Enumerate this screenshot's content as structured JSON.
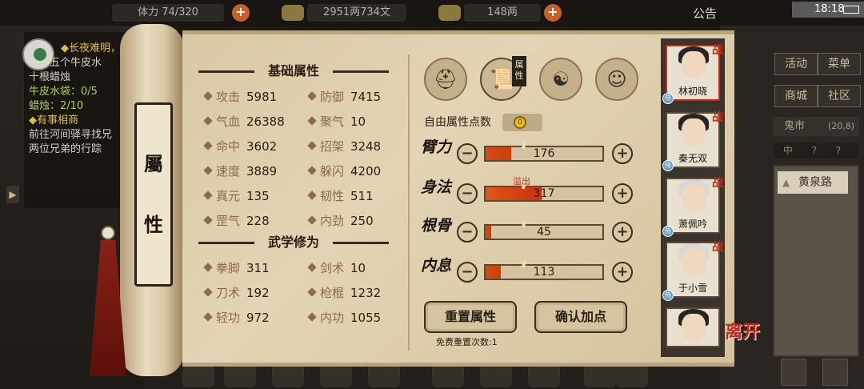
{
  "topbar": {
    "stamina": "体力 74/320",
    "money": "2951两734文",
    "gold": "148两",
    "notice": "公告",
    "time": "18:18"
  },
  "quest": {
    "q1_title": "◆长夜难明，",
    "q1_desc1": "筹备五个牛皮水",
    "q1_desc2": "十根蜡烛",
    "q1_prog1": "牛皮水袋：0/5",
    "q1_prog2": "蜡烛：2/10",
    "q2_title": "◆有事相商",
    "q2_desc1": "前往河间驿寻找兄",
    "q2_desc2": "两位兄弟的行踪"
  },
  "side_menu": {
    "activity": "活动",
    "menu": "菜单",
    "shop": "商城",
    "community": "社区",
    "ghost_market": "鬼市",
    "ghost_coords": "(20,8)",
    "middle": "中 ? ?",
    "location": "黄泉路"
  },
  "scroll": {
    "title_1": "屬",
    "title_2": "性"
  },
  "base_attributes": {
    "header": "基础属性",
    "items": [
      {
        "label": "攻击",
        "value": "5981"
      },
      {
        "label": "防御",
        "value": "7415"
      },
      {
        "label": "气血",
        "value": "26388"
      },
      {
        "label": "聚气",
        "value": "10"
      },
      {
        "label": "命中",
        "value": "3602"
      },
      {
        "label": "招架",
        "value": "3248"
      },
      {
        "label": "速度",
        "value": "3889"
      },
      {
        "label": "躲闪",
        "value": "4200"
      },
      {
        "label": "真元",
        "value": "135"
      },
      {
        "label": "韧性",
        "value": "511"
      },
      {
        "label": "罡气",
        "value": "228"
      },
      {
        "label": "内劲",
        "value": "250"
      }
    ]
  },
  "martial": {
    "header": "武学修为",
    "items": [
      {
        "label": "拳脚",
        "value": "311"
      },
      {
        "label": "剑术",
        "value": "10"
      },
      {
        "label": "刀术",
        "value": "192"
      },
      {
        "label": "枪棍",
        "value": "1232"
      },
      {
        "label": "轻功",
        "value": "972"
      },
      {
        "label": "内功",
        "value": "1055"
      }
    ]
  },
  "tabs": {
    "attr_tab_label": "属性"
  },
  "allocation": {
    "free_points_label": "自由属性点数",
    "free_points_value": "0",
    "overflow_label": "溢出",
    "attrs": [
      {
        "name": "臂力",
        "value": "176",
        "fill": 0.22
      },
      {
        "name": "身法",
        "value": "317",
        "fill": 0.48
      },
      {
        "name": "根骨",
        "value": "45",
        "fill": 0.05
      },
      {
        "name": "内息",
        "value": "113",
        "fill": 0.13
      }
    ],
    "minus": "−",
    "plus": "+",
    "reset_button": "重置属性",
    "confirm_button": "确认加点",
    "free_reset_text": "免费重置次数:1"
  },
  "roster": {
    "characters": [
      {
        "name": "林初晓",
        "tag": "战"
      },
      {
        "name": "秦无双",
        "tag": "战"
      },
      {
        "name": "萧佩吟",
        "tag": "战"
      },
      {
        "name": "于小雪",
        "tag": "战"
      },
      {
        "name": "",
        "tag": ""
      }
    ],
    "badge": "侍"
  },
  "leave_button": "离开",
  "colors": {
    "accent_red": "#c82818",
    "bar_fill": "#d84a12",
    "parchment": "#e2d4b4"
  }
}
